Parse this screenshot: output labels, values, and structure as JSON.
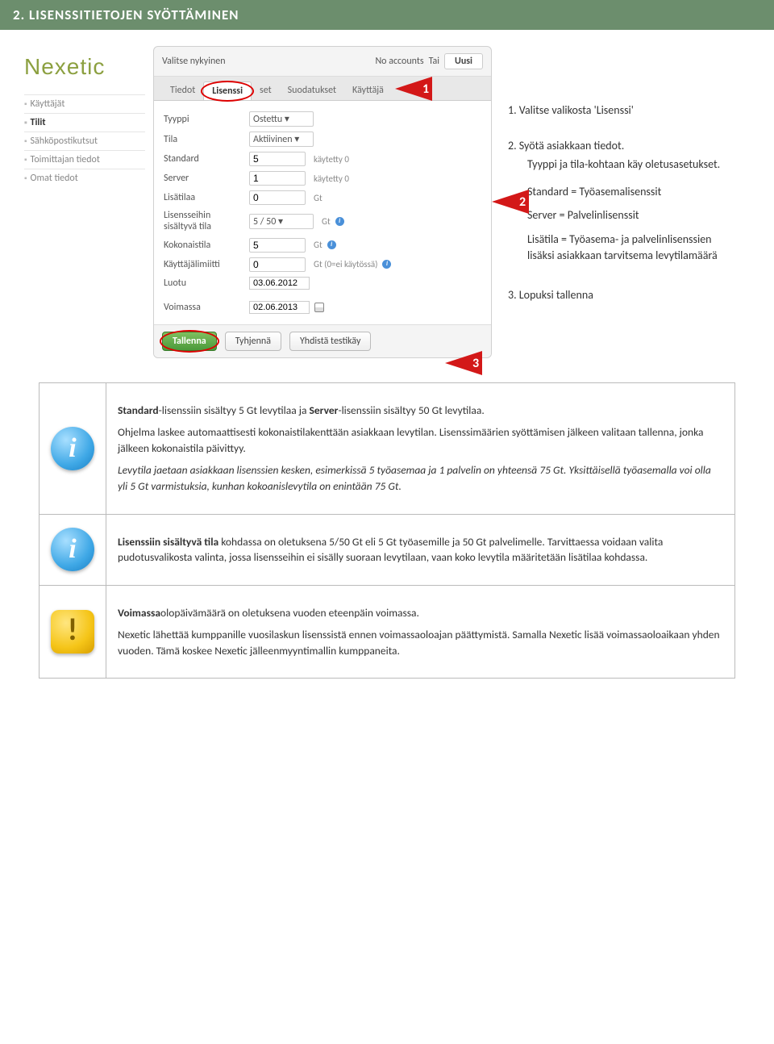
{
  "header": {
    "title": "2. LISENSSITIETOJEN SYÖTTÄMINEN"
  },
  "logo": "Nexetic",
  "nav": {
    "items": [
      {
        "label": "Käyttäjät",
        "active": false
      },
      {
        "label": "Tilit",
        "active": true
      },
      {
        "label": "Sähköpostikutsut",
        "active": false
      },
      {
        "label": "Toimittajan tiedot",
        "active": false
      },
      {
        "label": "Omat tiedot",
        "active": false
      }
    ]
  },
  "panel": {
    "top_label": "Valitse nykyinen",
    "no_accounts": "No accounts",
    "tai": "Tai",
    "uusi_btn": "Uusi",
    "tabs": [
      {
        "label": "Tiedot"
      },
      {
        "label": "Lisenssi"
      },
      {
        "label": "set"
      },
      {
        "label": "Suodatukset"
      },
      {
        "label": "Käyttäjä"
      }
    ],
    "form": {
      "tyyppi_label": "Tyyppi",
      "tyyppi_value": "Ostettu",
      "tila_label": "Tila",
      "tila_value": "Aktiivinen",
      "standard_label": "Standard",
      "standard_value": "5",
      "standard_note": "käytetty 0",
      "server_label": "Server",
      "server_value": "1",
      "server_note": "käytetty 0",
      "lisatilaa_label": "Lisätilaa",
      "lisatilaa_value": "0",
      "lisatilaa_note": "Gt",
      "lisensseihin_label": "Lisensseihin sisältyvä tila",
      "lisensseihin_value": "5 / 50",
      "lisensseihin_note": "Gt",
      "kokonaistila_label": "Kokonaistila",
      "kokonaistila_value": "5",
      "kokonaistila_note": "Gt",
      "kayttajalimitti_label": "Käyttäjälimiitti",
      "kayttajalimitti_value": "0",
      "kayttajalimitti_note": "Gt (0=ei käytössä)",
      "luotu_label": "Luotu",
      "luotu_value": "03.06.2012",
      "voimassa_label": "Voimassa",
      "voimassa_value": "02.06.2013"
    },
    "buttons": {
      "tallenna": "Tallenna",
      "tyhjenna": "Tyhjennä",
      "yhdista": "Yhdistä testikäy"
    }
  },
  "steps": {
    "s1": "1.   Valitse valikosta 'Lisenssi'",
    "s2": "2.   Syötä asiakkaan tiedot.",
    "s2a": "Tyyppi ja tila-kohtaan käy oletusasetukset.",
    "s2b": "Standard = Työasemalisenssit",
    "s2c": "Server = Palvelinlisenssit",
    "s2d": "Lisätila = Työasema- ja palvelinlisenssien lisäksi asiakkaan tarvitsema levytilamäärä",
    "s3": "3.   Lopuksi tallenna"
  },
  "info_boxes": {
    "b1": {
      "p1a": "Standard",
      "p1b": "-lisenssiin sisältyy 5 Gt levytilaa ja ",
      "p1c": "Server",
      "p1d": "-lisenssiin sisältyy 50 Gt levytilaa.",
      "p2": "Ohjelma laskee automaattisesti kokonaistilakenttään asiakkaan levytilan. Lisenssimäärien syöttämisen jälkeen valitaan tallenna, jonka jälkeen kokonaistila päivittyy.",
      "p3": "Levytila jaetaan asiakkaan lisenssien kesken, esimerkissä 5 työasemaa ja 1 palvelin on yhteensä 75 Gt. Yksittäisellä työasemalla voi olla yli 5 Gt varmistuksia, kunhan kokoanislevytila on enintään 75 Gt."
    },
    "b2": {
      "p1a": "Lisenssiin sisältyvä tila",
      "p1b": " kohdassa on oletuksena 5/50 Gt eli 5 Gt työasemille ja 50 Gt palvelimelle. Tarvittaessa voidaan valita pudotusvalikosta valinta, jossa lisensseihin ei sisälly suoraan levytilaan, vaan koko levytila määritetään lisätilaa kohdassa."
    },
    "b3": {
      "p1a": "Voimassa",
      "p1b": "olopäivämäärä on oletuksena vuoden eteenpäin voimassa.",
      "p2": "Nexetic lähettää kumppanille vuosilaskun lisenssistä ennen voimassaoloajan päättymistä. Samalla Nexetic lisää voimassaoloaikaan yhden vuoden. Tämä koskee Nexetic jälleenmyyntimallin kumppaneita."
    }
  }
}
